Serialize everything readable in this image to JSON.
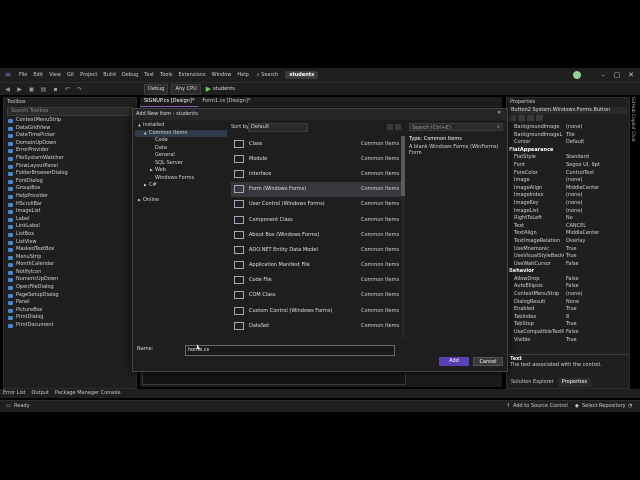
{
  "menubar": {
    "items": [
      "File",
      "Edit",
      "View",
      "Git",
      "Project",
      "Build",
      "Debug",
      "Test",
      "Tools",
      "Extensions",
      "Window",
      "Help"
    ],
    "search_label": "Search",
    "solution": "students"
  },
  "toolbar": {
    "config": "Debug",
    "platform": "Any CPU",
    "run_target": "students"
  },
  "toolbox": {
    "title": "Toolbox",
    "search_placeholder": "Search Toolbox",
    "items": [
      "ContextMenuStrip",
      "DataGridView",
      "DateTimePicker",
      "DomainUpDown",
      "ErrorProvider",
      "FileSystemWatcher",
      "FlowLayoutPanel",
      "FolderBrowserDialog",
      "FontDialog",
      "GroupBox",
      "HelpProvider",
      "HScrollBar",
      "ImageList",
      "Label",
      "LinkLabel",
      "ListBox",
      "ListView",
      "MaskedTextBox",
      "MenuStrip",
      "MonthCalendar",
      "NotifyIcon",
      "NumericUpDown",
      "OpenFileDialog",
      "PageSetupDialog",
      "Panel",
      "PictureBox",
      "PrintDialog",
      "PrintDocument"
    ]
  },
  "doc_tabs": [
    "SIGNUP.cs [Design]*",
    "Form1.cs [Design]*"
  ],
  "dialog": {
    "title": "Add New Item - students",
    "categories": [
      {
        "label": "Installed",
        "indent": 0,
        "arrow": "▲"
      },
      {
        "label": "Common Items",
        "indent": 1,
        "arrow": "▲",
        "selected": true
      },
      {
        "label": "Code",
        "indent": 2,
        "arrow": ""
      },
      {
        "label": "Data",
        "indent": 2,
        "arrow": ""
      },
      {
        "label": "General",
        "indent": 2,
        "arrow": ""
      },
      {
        "label": "SQL Server",
        "indent": 2,
        "arrow": ""
      },
      {
        "label": "Web",
        "indent": 2,
        "arrow": "▶"
      },
      {
        "label": "Windows Forms",
        "indent": 2,
        "arrow": ""
      },
      {
        "label": "C#",
        "indent": 1,
        "arrow": "▶"
      },
      {
        "label": "",
        "indent": 0,
        "arrow": ""
      },
      {
        "label": "Online",
        "indent": 0,
        "arrow": "▶"
      }
    ],
    "sort_label": "Sort by:",
    "sort_value": "Default",
    "search_placeholder": "Search (Ctrl+E)",
    "templates": [
      {
        "name": "Class",
        "category": "Common Items",
        "icon": "class-icon"
      },
      {
        "name": "Module",
        "category": "Common Items",
        "icon": "module-icon"
      },
      {
        "name": "Interface",
        "category": "Common Items",
        "icon": "interface-icon"
      },
      {
        "name": "Form (Windows Forms)",
        "category": "Common Items",
        "icon": "form-icon",
        "selected": true
      },
      {
        "name": "User Control (Windows Forms)",
        "category": "Common Items",
        "icon": "user-control-icon"
      },
      {
        "name": "Component Class",
        "category": "Common Items",
        "icon": "component-icon"
      },
      {
        "name": "About Box (Windows Forms)",
        "category": "Common Items",
        "icon": "about-box-icon"
      },
      {
        "name": "ADO.NET Entity Data Model",
        "category": "Common Items",
        "icon": "entity-model-icon"
      },
      {
        "name": "Application Manifest File",
        "category": "Common Items",
        "icon": "manifest-icon"
      },
      {
        "name": "Code File",
        "category": "Common Items",
        "icon": "code-file-icon"
      },
      {
        "name": "COM Class",
        "category": "Common Items",
        "icon": "com-class-icon"
      },
      {
        "name": "Custom Control (Windows Forms)",
        "category": "Common Items",
        "icon": "custom-control-icon"
      },
      {
        "name": "DataSet",
        "category": "Common Items",
        "icon": "dataset-icon"
      }
    ],
    "info_type": "Type:  Common Items",
    "info_desc": "A blank Windows Forms (WinForms) Form",
    "name_label": "Name:",
    "name_value": "home.cs",
    "add_label": "Add",
    "cancel_label": "Cancel"
  },
  "properties": {
    "title": "Properties",
    "object": "Button2  System.Windows.Forms.Button",
    "rows": [
      {
        "k": "BackgroundImage",
        "v": "(none)"
      },
      {
        "k": "BackgroundImageL",
        "v": "Tile"
      },
      {
        "k": "Cursor",
        "v": "Default"
      },
      {
        "k": "FlatAppearance",
        "v": "",
        "cat": true
      },
      {
        "k": "FlatStyle",
        "v": "Standard"
      },
      {
        "k": "Font",
        "v": "Segoe UI, 9pt"
      },
      {
        "k": "ForeColor",
        "v": "ControlText"
      },
      {
        "k": "Image",
        "v": "(none)"
      },
      {
        "k": "ImageAlign",
        "v": "MiddleCenter"
      },
      {
        "k": "ImageIndex",
        "v": "(none)"
      },
      {
        "k": "ImageKey",
        "v": "(none)"
      },
      {
        "k": "ImageList",
        "v": "(none)"
      },
      {
        "k": "RightToLeft",
        "v": "No"
      },
      {
        "k": "Text",
        "v": "CANCEL"
      },
      {
        "k": "TextAlign",
        "v": "MiddleCenter"
      },
      {
        "k": "TextImageRelation",
        "v": "Overlay"
      },
      {
        "k": "UseMnemonic",
        "v": "True"
      },
      {
        "k": "UseVisualStyleBackC",
        "v": "True"
      },
      {
        "k": "UseWaitCursor",
        "v": "False"
      },
      {
        "k": "Behavior",
        "v": "",
        "cat": true
      },
      {
        "k": "AllowDrop",
        "v": "False"
      },
      {
        "k": "AutoEllipsis",
        "v": "False"
      },
      {
        "k": "ContextMenuStrip",
        "v": "(none)"
      },
      {
        "k": "DialogResult",
        "v": "None"
      },
      {
        "k": "Enabled",
        "v": "True"
      },
      {
        "k": "TabIndex",
        "v": "8"
      },
      {
        "k": "TabStop",
        "v": "True"
      },
      {
        "k": "UseCompatibleTextR",
        "v": "False"
      },
      {
        "k": "Visible",
        "v": "True"
      }
    ],
    "desc_title": "Text",
    "desc_text": "The text associated with the control.",
    "bottom_tabs": [
      "Solution Explorer",
      "Properties"
    ]
  },
  "side_strip": [
    "GitHub Copilot Chat"
  ],
  "bottom_tabs": [
    "Error List",
    "Output",
    "Package Manager Console"
  ],
  "status": {
    "ready": "Ready",
    "source_control": "Add to Source Control",
    "repository": "Select Repository"
  }
}
